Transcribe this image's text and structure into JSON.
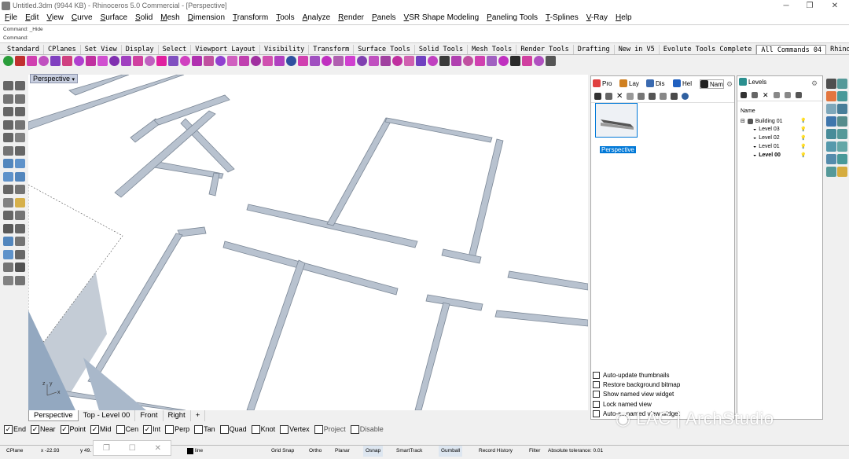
{
  "window": {
    "title": "Untitled.3dm (9944 KB) - Rhinoceros 5.0 Commercial - [Perspective]",
    "minimize": "─",
    "maximize": "❐",
    "close": "✕"
  },
  "menubar": [
    "File",
    "Edit",
    "View",
    "Curve",
    "Surface",
    "Solid",
    "Mesh",
    "Dimension",
    "Transform",
    "Tools",
    "Analyze",
    "Render",
    "Panels",
    "VSR Shape Modeling",
    "Paneling Tools",
    "T-Splines",
    "V-Ray",
    "Help"
  ],
  "command": {
    "history": "Command: _Hide",
    "prompt": "Command:"
  },
  "toolbar_tabs": [
    "Standard",
    "CPlanes",
    "Set View",
    "Display",
    "Select",
    "Viewport Layout",
    "Visibility",
    "Transform",
    "Surface Tools",
    "Solid Tools",
    "Mesh Tools",
    "Render Tools",
    "Drafting",
    "New in V5",
    "Evolute Tools Complete",
    "All Commands 04",
    "RhinoVAULT",
    "Weaverbir"
  ],
  "active_toolbar_tab": "All Commands 04",
  "viewport": {
    "label": "Perspective",
    "tabs": [
      "Perspective",
      "Top - Level 00",
      "Front",
      "Right",
      "+"
    ],
    "active": "Perspective"
  },
  "named_views": {
    "tabs": [
      "Pro",
      "Lay",
      "Dis",
      "Hel",
      "Nam"
    ],
    "thumbnail_label": "Perspective",
    "options": [
      "Auto-update thumbnails",
      "Restore background bitmap",
      "Show named view widget",
      "Lock named view",
      "Auto-s...named view widget"
    ]
  },
  "layers": {
    "title": "Levels",
    "column": "Name",
    "items": [
      {
        "name": "Building 01",
        "bold": false,
        "indent": 0
      },
      {
        "name": "Level 03",
        "bold": false,
        "indent": 1
      },
      {
        "name": "Level 02",
        "bold": false,
        "indent": 1
      },
      {
        "name": "Level 01",
        "bold": false,
        "indent": 1
      },
      {
        "name": "Level 00",
        "bold": true,
        "indent": 1
      }
    ]
  },
  "osnap": [
    {
      "label": "End",
      "checked": true
    },
    {
      "label": "Near",
      "checked": true
    },
    {
      "label": "Point",
      "checked": true
    },
    {
      "label": "Mid",
      "checked": true
    },
    {
      "label": "Cen",
      "checked": false
    },
    {
      "label": "Int",
      "checked": true
    },
    {
      "label": "Perp",
      "checked": false
    },
    {
      "label": "Tan",
      "checked": false
    },
    {
      "label": "Quad",
      "checked": false
    },
    {
      "label": "Knot",
      "checked": false
    },
    {
      "label": "Vertex",
      "checked": false
    },
    {
      "label": "Project",
      "checked": false
    },
    {
      "label": "Disable",
      "checked": false
    }
  ],
  "status": {
    "cplane": "CPlane",
    "x": "x -22.93",
    "y": "y 49.",
    "layer": "line",
    "buttons": [
      "Grid Snap",
      "Ortho",
      "Planar",
      "Osnap",
      "SmartTrack",
      "Gumball",
      "Record History",
      "Filter"
    ],
    "tolerance": "Absolute tolerance: 0.01"
  },
  "watermark": "LAC | ArchStudio",
  "colors": {
    "viewport_bg": "#ffffff",
    "slot_fill": "#b8c2cf",
    "accent": "#0078d7"
  }
}
